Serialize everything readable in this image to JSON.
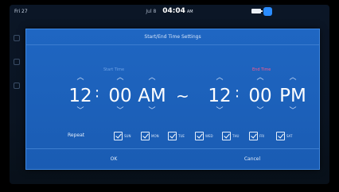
{
  "status": {
    "left": "Fri 27",
    "date": "Jul 8",
    "time": "04:04",
    "ampm": "AM"
  },
  "dialog": {
    "title": "Start/End Time Settings",
    "start_label": "Start Time",
    "end_label": "End Time",
    "start": {
      "hour": "12",
      "minute": "00",
      "ampm": "AM"
    },
    "end": {
      "hour": "12",
      "minute": "00",
      "ampm": "PM"
    },
    "range_sep": "~",
    "colon": ":",
    "repeat_label": "Repeat",
    "days": [
      {
        "label": "SUN",
        "checked": true
      },
      {
        "label": "MON",
        "checked": true
      },
      {
        "label": "TUE",
        "checked": true
      },
      {
        "label": "WED",
        "checked": true
      },
      {
        "label": "THU",
        "checked": true
      },
      {
        "label": "FRI",
        "checked": true
      },
      {
        "label": "SAT",
        "checked": true
      }
    ],
    "ok_label": "OK",
    "cancel_label": "Cancel"
  },
  "colors": {
    "dialog_bg": "#1f66c2",
    "start_label": "#6fa3e6",
    "end_label": "#ff5a8a"
  },
  "icons": [
    "battery-icon",
    "connectivity-icon",
    "chevron-up-icon",
    "chevron-down-icon",
    "checkbox-icon"
  ]
}
